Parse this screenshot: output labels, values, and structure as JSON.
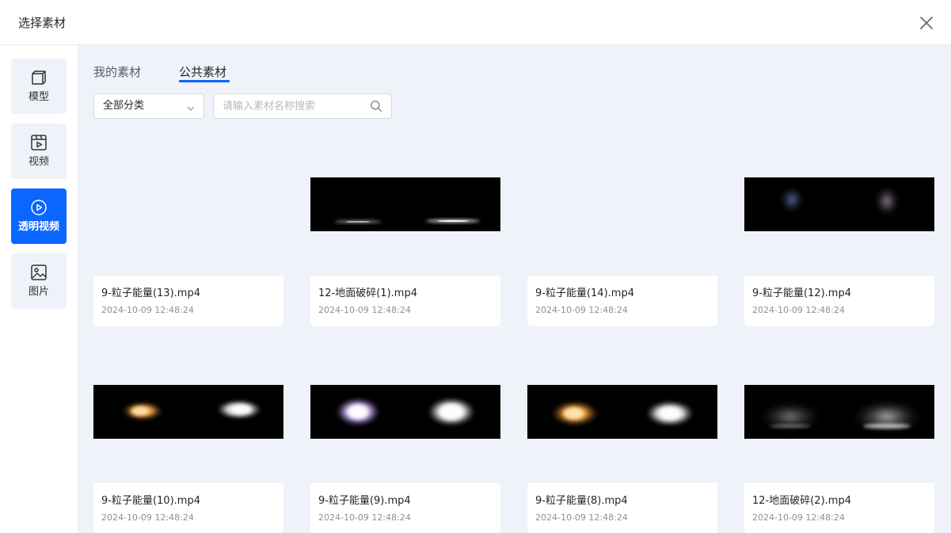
{
  "dialog": {
    "title": "选择素材",
    "close_icon": "close-icon"
  },
  "sidebar": {
    "items": [
      {
        "label": "模型",
        "icon": "cube-icon",
        "active": false
      },
      {
        "label": "视频",
        "icon": "video-icon",
        "active": false
      },
      {
        "label": "透明视频",
        "icon": "play-circle-icon",
        "active": true
      },
      {
        "label": "图片",
        "icon": "image-icon",
        "active": false
      }
    ]
  },
  "tabs": [
    {
      "label": "我的素材",
      "active": false
    },
    {
      "label": "公共素材",
      "active": true
    }
  ],
  "filter": {
    "category_value": "全部分类"
  },
  "search": {
    "placeholder": "请输入素材名称搜索",
    "value": ""
  },
  "colors": {
    "accent": "#0a66ff",
    "panel_bg": "#eff2f9"
  },
  "materials": [
    {
      "name": "9-粒子能量(13).mp4",
      "time": "2024-10-09 12:48:24",
      "thumb": "none"
    },
    {
      "name": "12-地面破碎(1).mp4",
      "time": "2024-10-09 12:48:24",
      "thumb": "ground"
    },
    {
      "name": "9-粒子能量(14).mp4",
      "time": "2024-10-09 12:48:24",
      "thumb": "none"
    },
    {
      "name": "9-粒子能量(12).mp4",
      "time": "2024-10-09 12:48:24",
      "thumb": "faint"
    },
    {
      "name": "9-粒子能量(10).mp4",
      "time": "2024-10-09 12:48:24",
      "thumb": "fire"
    },
    {
      "name": "9-粒子能量(9).mp4",
      "time": "2024-10-09 12:48:24",
      "thumb": "violet"
    },
    {
      "name": "9-粒子能量(8).mp4",
      "time": "2024-10-09 12:48:24",
      "thumb": "orange"
    },
    {
      "name": "12-地面破碎(2).mp4",
      "time": "2024-10-09 12:48:24",
      "thumb": "dust"
    }
  ]
}
